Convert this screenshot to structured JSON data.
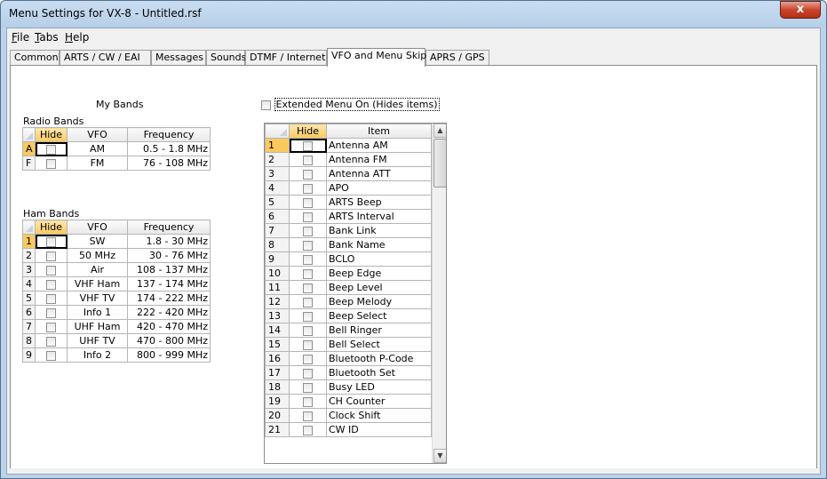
{
  "window": {
    "title": "Menu Settings for VX-8 - Untitled.rsf",
    "close": "x"
  },
  "menu": {
    "file": "File",
    "file_u": "F",
    "file_rest": "ile",
    "tabs_u": "T",
    "tabs_rest": "abs",
    "help_u": "H",
    "help_rest": "elp"
  },
  "tabs": [
    "Common",
    "ARTS / CW / EAI",
    "Messages",
    "Sounds",
    "DTMF / Internet",
    "VFO and Menu Skip",
    "APRS / GPS"
  ],
  "active_tab": "VFO and Menu Skip",
  "my_bands": {
    "heading": "My Bands",
    "radio_label": "Radio Bands",
    "ham_label": "Ham Bands",
    "headers": {
      "hide": "Hide",
      "vfo": "VFO",
      "freq": "Frequency"
    },
    "radio_rows": [
      {
        "id": "A",
        "vfo": "AM",
        "freq": "0.5 - 1.8 MHz"
      },
      {
        "id": "F",
        "vfo": "FM",
        "freq": "76 - 108 MHz"
      }
    ],
    "ham_rows": [
      {
        "id": "1",
        "vfo": "SW",
        "freq": "1.8 - 30 MHz"
      },
      {
        "id": "2",
        "vfo": "50 MHz",
        "freq": "30 - 76 MHz"
      },
      {
        "id": "3",
        "vfo": "Air",
        "freq": "108 - 137 MHz"
      },
      {
        "id": "4",
        "vfo": "VHF Ham",
        "freq": "137 - 174 MHz"
      },
      {
        "id": "5",
        "vfo": "VHF TV",
        "freq": "174 - 222 MHz"
      },
      {
        "id": "6",
        "vfo": "Info 1",
        "freq": "222 - 420 MHz"
      },
      {
        "id": "7",
        "vfo": "UHF Ham",
        "freq": "420 - 470 MHz"
      },
      {
        "id": "8",
        "vfo": "UHF TV",
        "freq": "470 - 800 MHz"
      },
      {
        "id": "9",
        "vfo": "Info 2",
        "freq": "800 - 999 MHz"
      }
    ]
  },
  "menu_skip": {
    "extended_label": "Extended Menu On (Hides items)",
    "headers": {
      "hide": "Hide",
      "item": "Item"
    },
    "rows": [
      {
        "id": "1",
        "item": "Antenna AM"
      },
      {
        "id": "2",
        "item": "Antenna FM"
      },
      {
        "id": "3",
        "item": "Antenna ATT"
      },
      {
        "id": "4",
        "item": "APO"
      },
      {
        "id": "5",
        "item": "ARTS Beep"
      },
      {
        "id": "6",
        "item": "ARTS Interval"
      },
      {
        "id": "7",
        "item": "Bank Link"
      },
      {
        "id": "8",
        "item": "Bank Name"
      },
      {
        "id": "9",
        "item": "BCLO"
      },
      {
        "id": "10",
        "item": "Beep Edge"
      },
      {
        "id": "11",
        "item": "Beep Level"
      },
      {
        "id": "12",
        "item": "Beep Melody"
      },
      {
        "id": "13",
        "item": "Beep Select"
      },
      {
        "id": "14",
        "item": "Bell Ringer"
      },
      {
        "id": "15",
        "item": "Bell Select"
      },
      {
        "id": "16",
        "item": "Bluetooth P-Code"
      },
      {
        "id": "17",
        "item": "Bluetooth Set"
      },
      {
        "id": "18",
        "item": "Busy LED"
      },
      {
        "id": "19",
        "item": "CH Counter"
      },
      {
        "id": "20",
        "item": "Clock Shift"
      },
      {
        "id": "21",
        "item": "CW ID"
      }
    ]
  },
  "colors": {
    "accent_selected": "#f9c95e",
    "titlebar": "#bcd3ea",
    "close": "#c9462c"
  }
}
